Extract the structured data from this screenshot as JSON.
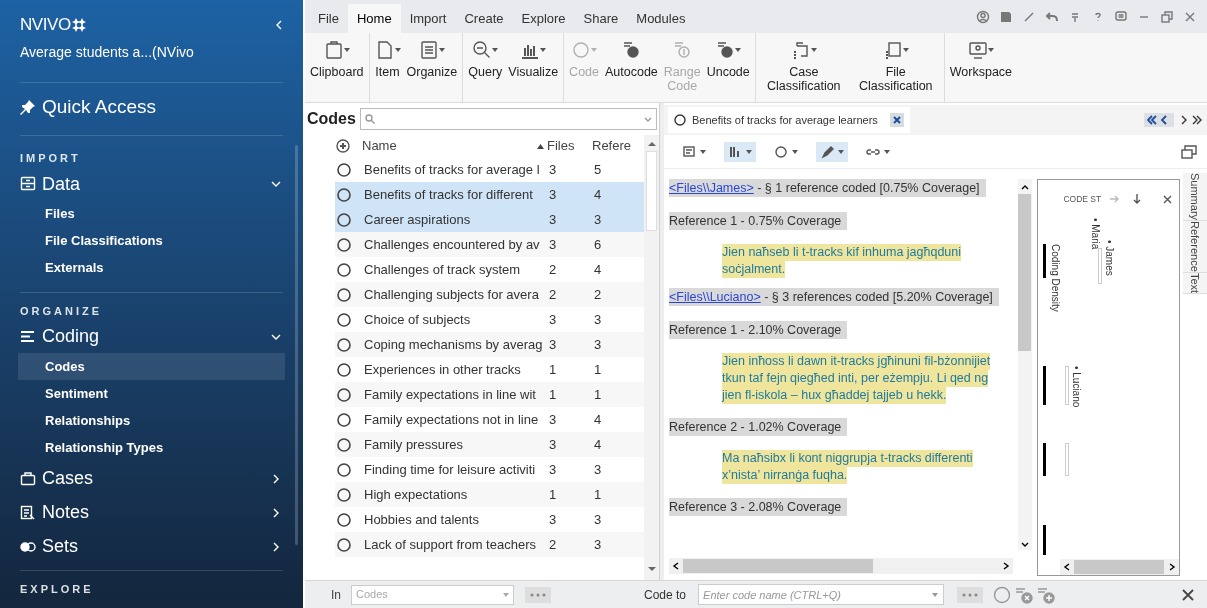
{
  "sidebar": {
    "logo": "NVIVO",
    "project": "Average students a...(NVivo",
    "quick_access": "Quick Access",
    "sections": [
      {
        "label": "IMPORT",
        "groups": [
          {
            "kind": "data",
            "label": "Data",
            "expanded": true,
            "children": [
              {
                "label": "Files",
                "selected": false
              },
              {
                "label": "File Classifications",
                "selected": false
              },
              {
                "label": "Externals",
                "selected": false
              }
            ]
          }
        ]
      },
      {
        "label": "ORGANIZE",
        "groups": [
          {
            "kind": "coding",
            "label": "Coding",
            "expanded": true,
            "children": [
              {
                "label": "Codes",
                "selected": true
              },
              {
                "label": "Sentiment",
                "selected": false
              },
              {
                "label": "Relationships",
                "selected": false
              },
              {
                "label": "Relationship Types",
                "selected": false
              }
            ]
          },
          {
            "kind": "cases",
            "label": "Cases",
            "expanded": false
          },
          {
            "kind": "notes",
            "label": "Notes",
            "expanded": false
          },
          {
            "kind": "sets",
            "label": "Sets",
            "expanded": false
          }
        ]
      },
      {
        "label": "EXPLORE"
      }
    ]
  },
  "ribbon": {
    "tabs": [
      {
        "label": "File",
        "selected": false
      },
      {
        "label": "Home",
        "selected": true
      },
      {
        "label": "Import",
        "selected": false
      },
      {
        "label": "Create",
        "selected": false
      },
      {
        "label": "Explore",
        "selected": false
      },
      {
        "label": "Share",
        "selected": false
      },
      {
        "label": "Modules",
        "selected": false
      }
    ],
    "groups": [
      [
        {
          "label": "Clipboard",
          "disabled": false
        }
      ],
      [
        {
          "label": "Item",
          "disabled": false
        },
        {
          "label": "Organize",
          "disabled": false
        }
      ],
      [
        {
          "label": "Query",
          "disabled": false
        },
        {
          "label": "Visualize",
          "disabled": false
        }
      ],
      [
        {
          "label": "Code",
          "disabled": true
        },
        {
          "label": "Autocode",
          "disabled": false
        },
        {
          "label": "Range Code",
          "disabled": true
        },
        {
          "label": "Uncode",
          "disabled": false
        }
      ],
      [
        {
          "label": "Case Classification",
          "disabled": false
        },
        {
          "label": "File Classification",
          "disabled": false
        }
      ],
      [
        {
          "label": "Workspace",
          "disabled": false
        }
      ]
    ]
  },
  "codes": {
    "title": "Codes",
    "columns": [
      "Name",
      "Files",
      "Refere"
    ],
    "rows": [
      {
        "name": "Benefits of tracks for average l",
        "files": "3",
        "refs": "5",
        "selected": false
      },
      {
        "name": "Benefits of tracks for different",
        "files": "3",
        "refs": "4",
        "selected": true
      },
      {
        "name": "Career aspirations",
        "files": "3",
        "refs": "3",
        "selected": true
      },
      {
        "name": "Challenges encountered by av",
        "files": "3",
        "refs": "6",
        "selected": false
      },
      {
        "name": "Challenges of track system",
        "files": "2",
        "refs": "4",
        "selected": false
      },
      {
        "name": "Challenging subjects for avera",
        "files": "2",
        "refs": "2",
        "selected": false
      },
      {
        "name": "Choice of subjects",
        "files": "3",
        "refs": "3",
        "selected": false
      },
      {
        "name": "Coping mechanisms by averag",
        "files": "3",
        "refs": "3",
        "selected": false
      },
      {
        "name": "Experiences in other tracks",
        "files": "1",
        "refs": "1",
        "selected": false
      },
      {
        "name": "Family expectations in line wit",
        "files": "1",
        "refs": "1",
        "selected": false
      },
      {
        "name": "Family expectations not in line",
        "files": "3",
        "refs": "4",
        "selected": false
      },
      {
        "name": "Family pressures",
        "files": "3",
        "refs": "4",
        "selected": false
      },
      {
        "name": "Finding time for leisure activiti",
        "files": "3",
        "refs": "3",
        "selected": false
      },
      {
        "name": "High expectations",
        "files": "1",
        "refs": "1",
        "selected": false
      },
      {
        "name": "Hobbies and talents",
        "files": "3",
        "refs": "3",
        "selected": false
      },
      {
        "name": "Lack of support from teachers",
        "files": "2",
        "refs": "3",
        "selected": false
      }
    ]
  },
  "detail": {
    "tab": "Benefits of tracks for average learners",
    "documents": [
      {
        "link": "<Files\\\\James>",
        "summary": " - § 1 reference coded  [0.75% Coverage]",
        "references": [
          {
            "heading": "Reference 1 - 0.75% Coverage",
            "lines": [
              "Jien naħseb li t-tracks kif inhuma jagħqduni",
              "soċjalment."
            ]
          }
        ]
      },
      {
        "link": "<Files\\\\Luciano>",
        "summary": " - § 3 references coded  [5.20% Coverage]",
        "references": [
          {
            "heading": "Reference 1 - 2.10% Coverage",
            "lines": [
              "Jien inħoss li dawn it-tracks jgħinuni fil-bżonnijiet",
              "tkun taf fejn qiegħed inti, per eżempju.  Li qed ng",
              "jien fl-iskola – hux għaddej tajjeb u hekk."
            ]
          },
          {
            "heading": "Reference 2 - 1.02% Coverage",
            "lines": [
              "Ma naħsibx li kont niggrupja t-tracks differenti",
              "x’nista’ nirranġa fuqha."
            ]
          },
          {
            "heading": "Reference 3 - 2.08% Coverage"
          }
        ]
      }
    ],
    "stripes": {
      "title": "CODE ST",
      "density": "Coding Density",
      "cases": [
        "• Maria",
        "• James",
        "• Luciano"
      ]
    },
    "side_tabs": [
      "Summary",
      "Reference",
      "Text"
    ]
  },
  "bottom": {
    "in_label": "In",
    "in_value": "Codes",
    "code_to": "Code to",
    "code_placeholder": "Enter code name (CTRL+Q)"
  }
}
